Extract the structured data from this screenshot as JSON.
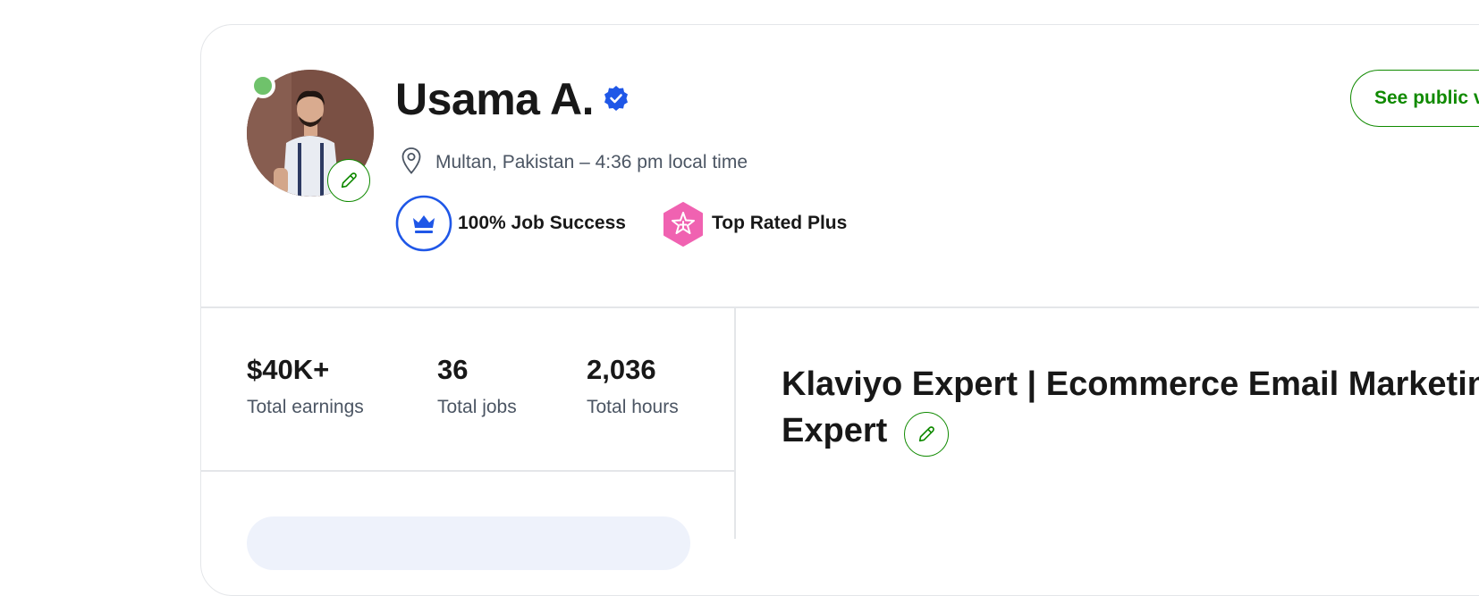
{
  "profile": {
    "name": "Usama A.",
    "location": "Multan, Pakistan – 4:36 pm local time",
    "badges": {
      "job_success": "100% Job Success",
      "top_rated": "Top Rated Plus"
    },
    "see_public_label": "See public view",
    "status": "online"
  },
  "stats": {
    "earnings": {
      "value": "$40K+",
      "label": "Total earnings"
    },
    "jobs": {
      "value": "36",
      "label": "Total jobs"
    },
    "hours": {
      "value": "2,036",
      "label": "Total hours"
    }
  },
  "headline": {
    "line1": "Klaviyo Expert | Ecommerce Email Marketing",
    "line2": "Expert"
  },
  "colors": {
    "accent": "#108a00",
    "verified": "#1f57e7",
    "online": "#6fc26b",
    "job_success": "#1f57e7",
    "top_rated": "#f062b1"
  },
  "icons": [
    "verified-badge-icon",
    "location-pin-icon",
    "crown-icon",
    "star-icon",
    "pencil-icon"
  ]
}
